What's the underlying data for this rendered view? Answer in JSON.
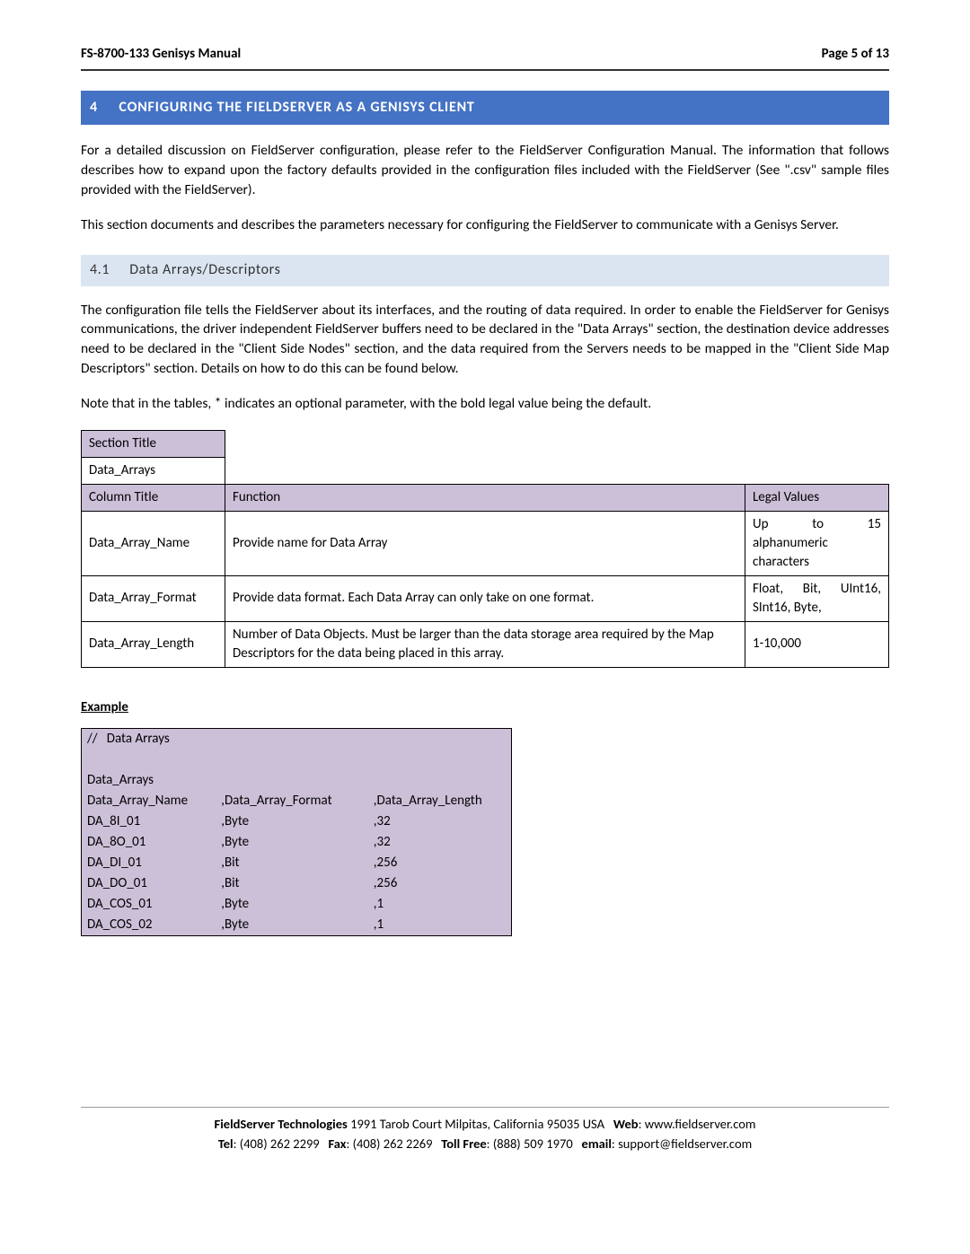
{
  "header": {
    "doc_title": "FS-8700-133 Genisys Manual",
    "page_label": "Page 5 of 13"
  },
  "section": {
    "number": "4",
    "title": "CONFIGURING THE FIELDSERVER AS A GENISYS CLIENT"
  },
  "para1": "For a detailed discussion on FieldServer configuration, please refer to the FieldServer Configuration Manual.  The information that follows describes how to expand upon the factory defaults provided in the configuration files included with the FieldServer (See \".csv\" sample files provided with the FieldServer).",
  "para2": "This section documents and describes the parameters necessary for configuring the FieldServer to communicate with a Genisys Server.",
  "subsection": {
    "number": "4.1",
    "title": "Data Arrays/Descriptors"
  },
  "para3": "The configuration file tells the FieldServer about its interfaces, and the routing of data required.  In order to enable the FieldServer for Genisys communications, the driver independent FieldServer buffers need to be declared in the \"Data Arrays\" section, the destination device addresses need to be declared in the \"Client Side Nodes\" section, and the data required from the Servers needs to be mapped in the \"Client Side Map Descriptors\" section.  Details on how to do this can be found below.",
  "para4": "Note that in the tables, * indicates an optional parameter, with the bold legal value being the default.",
  "spec_table": {
    "section_title_label": "Section Title",
    "section_title_value": "Data_Arrays",
    "column_title_label": "Column Title",
    "function_label": "Function",
    "legal_values_label": "Legal Values",
    "rows": [
      {
        "col": "Data_Array_Name",
        "func": "Provide name for Data Array",
        "legal_line1": "Up to 15",
        "legal_line2": "alphanumeric",
        "legal_line3": "characters"
      },
      {
        "col": "Data_Array_Format",
        "func": "Provide data format. Each Data Array can only take on one format.",
        "legal_line1": "Float, Bit, UInt16,",
        "legal_line2": "SInt16, Byte,"
      },
      {
        "col": "Data_Array_Length",
        "func": "Number of Data Objects. Must be larger than the data storage area required by the Map Descriptors for the data being placed in this array.",
        "legal": "1-10,000"
      }
    ]
  },
  "example_label": "Example",
  "example": {
    "comment_prefix": "//",
    "comment_text": "Data Arrays",
    "block_name": "Data_Arrays",
    "header": [
      "Data_Array_Name",
      ",Data_Array_Format",
      ",Data_Array_Length"
    ],
    "rows": [
      [
        "DA_8I_01",
        ",Byte",
        ",32"
      ],
      [
        "DA_8O_01",
        ",Byte",
        ",32"
      ],
      [
        "DA_DI_01",
        ",Bit",
        ",256"
      ],
      [
        "DA_DO_01",
        ",Bit",
        ",256"
      ],
      [
        "DA_COS_01",
        ",Byte",
        ",1"
      ],
      [
        "DA_COS_02",
        ",Byte",
        ",1"
      ]
    ]
  },
  "footer": {
    "company": "FieldServer Technologies",
    "address": "1991 Tarob Court Milpitas, California 95035 USA",
    "web_label": "Web",
    "web": "www.fieldserver.com",
    "tel_label": "Tel",
    "tel": "(408) 262 2299",
    "fax_label": "Fax",
    "fax": "(408) 262 2269",
    "tollfree_label": "Toll Free",
    "tollfree": "(888) 509 1970",
    "email_label": "email",
    "email": "support@fieldserver.com"
  }
}
